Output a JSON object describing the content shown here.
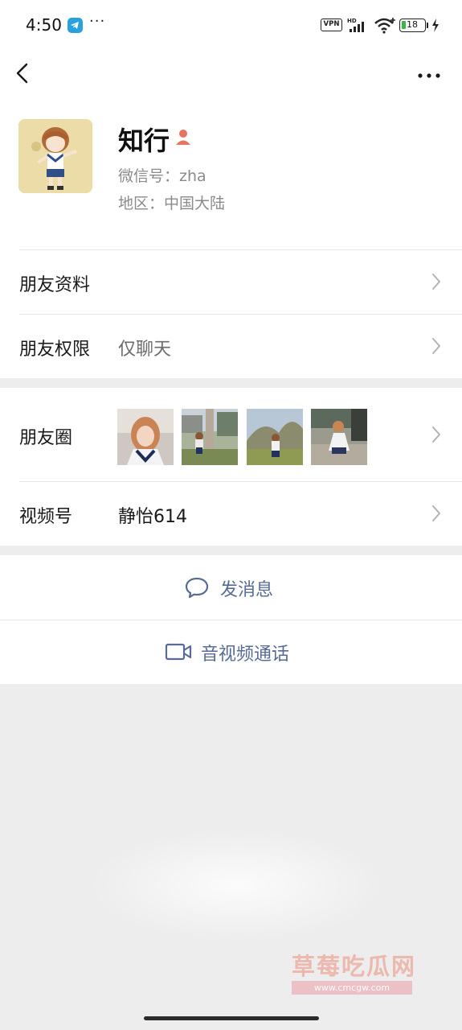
{
  "status_bar": {
    "time": "4:50",
    "more": "···",
    "vpn": "VPN",
    "network": "HD",
    "battery": "18",
    "battery_level": 0.18,
    "battery_color": "#3bb54a"
  },
  "nav": {
    "back_icon": "chevron-left-icon",
    "more_icon": "more-horizontal-icon"
  },
  "profile": {
    "name": "知行",
    "wechat_id": "微信号：zha",
    "region": "地区：中国大陆",
    "avatar_icon": "anime-avatar"
  },
  "rows": {
    "friend_info": {
      "label": "朋友资料"
    },
    "friend_permission": {
      "label": "朋友权限",
      "value": "仅聊天"
    },
    "moments": {
      "label": "朋友圈"
    },
    "channels": {
      "label": "视频号",
      "value": "静怡614"
    }
  },
  "actions": {
    "message": {
      "label": "发消息",
      "icon": "chat-bubble-icon"
    },
    "call": {
      "label": "音视频通话",
      "icon": "video-camera-icon"
    }
  },
  "watermark": {
    "title": "草莓吃瓜网",
    "url": "www.cmcgw.com"
  },
  "colors": {
    "link": "#576b95",
    "background": "#ededed"
  }
}
